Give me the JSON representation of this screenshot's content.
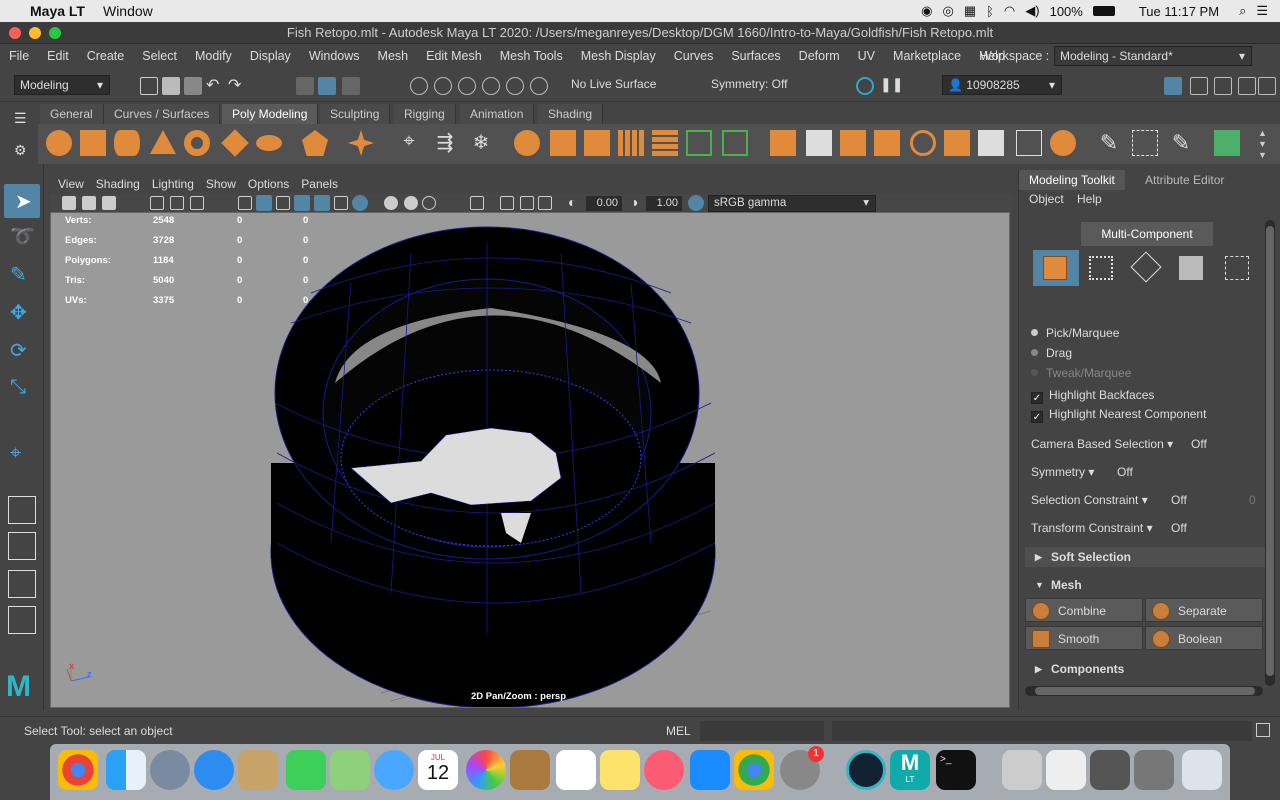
{
  "macos": {
    "app_name": "Maya LT",
    "menu": [
      "Window"
    ],
    "battery": "100%",
    "clock": "Tue 11:17 PM"
  },
  "window": {
    "title": "Fish Retopo.mlt - Autodesk Maya LT 2020: /Users/meganreyes/Desktop/DGM 1660/Intro-to-Maya/Goldfish/Fish Retopo.mlt"
  },
  "menubar": {
    "items": [
      "File",
      "Edit",
      "Create",
      "Select",
      "Modify",
      "Display",
      "Windows",
      "Mesh",
      "Edit Mesh",
      "Mesh Tools",
      "Mesh Display",
      "Curves",
      "Surfaces",
      "Deform",
      "UV",
      "Marketplace",
      "Help"
    ],
    "workspace_label": "Workspace :",
    "workspace_value": "Modeling - Standard*"
  },
  "status": {
    "menuset": "Modeling",
    "live_surface": "No Live Surface",
    "symmetry": "Symmetry: Off",
    "user_id": "10908285"
  },
  "shelf": {
    "tabs": [
      "General",
      "Curves / Surfaces",
      "Poly Modeling",
      "Sculpting",
      "Rigging",
      "Animation",
      "Shading"
    ],
    "active": "Poly Modeling"
  },
  "viewport": {
    "menu": [
      "View",
      "Shading",
      "Lighting",
      "Show",
      "Options",
      "Panels"
    ],
    "exposure": "0.00",
    "gamma": "1.00",
    "colorspace": "sRGB gamma",
    "hud": [
      {
        "label": "Verts:",
        "a": "2548",
        "b": "0",
        "c": "0"
      },
      {
        "label": "Edges:",
        "a": "3728",
        "b": "0",
        "c": "0"
      },
      {
        "label": "Polygons:",
        "a": "1184",
        "b": "0",
        "c": "0"
      },
      {
        "label": "Tris:",
        "a": "5040",
        "b": "0",
        "c": "0"
      },
      {
        "label": "UVs:",
        "a": "3375",
        "b": "0",
        "c": "0"
      }
    ],
    "camera_label": "2D Pan/Zoom : persp",
    "axis_x": "x",
    "axis_z": "z"
  },
  "toolkit": {
    "tabs": [
      "Modeling Toolkit",
      "Attribute Editor"
    ],
    "menu": [
      "Object",
      "Help"
    ],
    "multi_component": "Multi-Component",
    "pick_marquee": "Pick/Marquee",
    "drag": "Drag",
    "tweak_marquee": "Tweak/Marquee",
    "highlight_backfaces": "Highlight Backfaces",
    "highlight_nearest": "Highlight Nearest Component",
    "camera_based_selection": "Camera Based Selection",
    "camera_based_value": "Off",
    "symmetry": "Symmetry",
    "symmetry_value": "Off",
    "selection_constraint": "Selection Constraint",
    "selection_constraint_value": "Off",
    "selection_constraint_num": "0",
    "transform_constraint": "Transform Constraint",
    "transform_constraint_value": "Off",
    "soft_selection": "Soft Selection",
    "mesh": "Mesh",
    "combine": "Combine",
    "separate": "Separate",
    "smooth": "Smooth",
    "boolean": "Boolean",
    "components": "Components"
  },
  "helpline": {
    "text": "Select Tool: select an object",
    "mel": "MEL"
  },
  "dock": {
    "calendar_month": "JUL",
    "calendar_day": "12",
    "badge": "1",
    "maya_lt": "LT"
  },
  "colors": {
    "accent": "#5285a6",
    "orange_icon": "#e08a3c",
    "viewport_bg": "#9a9a9a",
    "wire": "#1a1a8a"
  }
}
